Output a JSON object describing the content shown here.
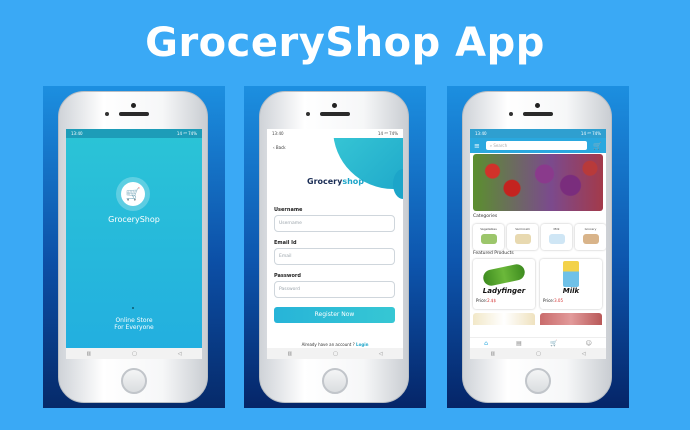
{
  "headline": "GroceryShop App",
  "status_time": "13:40",
  "status_right": "14 ⁴ᴳ 74%",
  "splash": {
    "app_name": "GroceryShop",
    "tagline_line1": "Online Store",
    "tagline_line2": "For Everyone"
  },
  "register": {
    "back_label": "Back",
    "brand_a": "Grocery",
    "brand_b": "shop",
    "username_label": "Username",
    "username_placeholder": "Username",
    "email_label": "Email Id",
    "email_placeholder": "Email",
    "password_label": "Password",
    "password_placeholder": "Password",
    "register_button": "Register Now",
    "already_text": "Already have an account ?",
    "login_link": "Login"
  },
  "home": {
    "search_placeholder": "Search",
    "categories_title": "Categories",
    "categories": [
      "Vegetables",
      "Vermicelli",
      "Milk",
      "Grocery"
    ],
    "featured_title": "Featured Products",
    "products": [
      {
        "name": "Ladyfinger",
        "price_label": "Price:",
        "price": "2.$$"
      },
      {
        "name": "Milk",
        "price_label": "Price:",
        "price": "3.05"
      }
    ]
  },
  "icons": {
    "cart": "shopping-cart",
    "menu": "hamburger",
    "home": "home",
    "chat": "chat",
    "profile": "person"
  },
  "colors": {
    "background": "#3aa9f5",
    "accent": "#22b5d8",
    "brand_dark": "#1a2d55"
  }
}
